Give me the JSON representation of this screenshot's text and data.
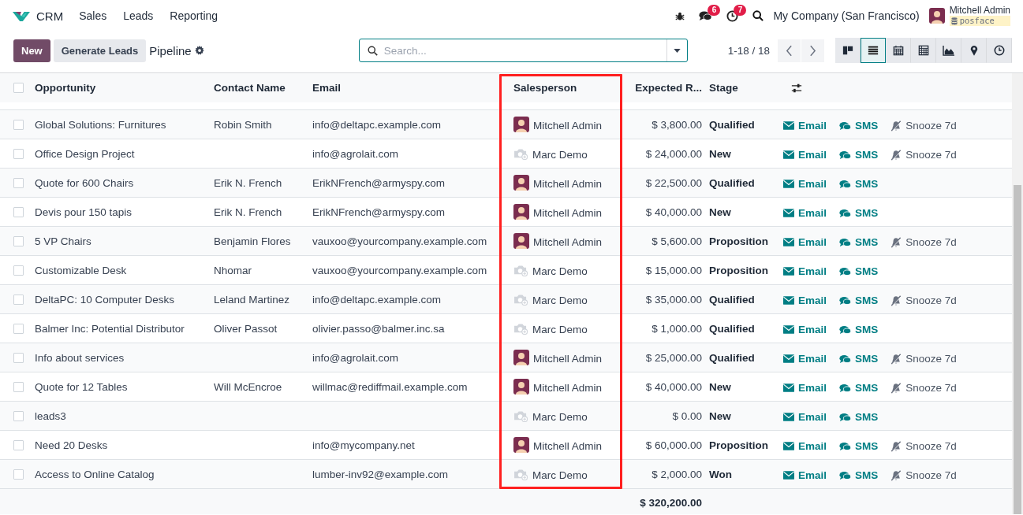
{
  "nav": {
    "app": "CRM",
    "menu": [
      "Sales",
      "Leads",
      "Reporting"
    ]
  },
  "systray": {
    "messages_badge": "6",
    "activities_badge": "7",
    "company": "My Company (San Francisco)",
    "user": "Mitchell Admin",
    "database": "posface"
  },
  "control_panel": {
    "new_button": "New",
    "generate_button": "Generate Leads",
    "breadcrumb": "Pipeline",
    "search": {
      "placeholder": "Search..."
    },
    "pager": "1-18 / 18",
    "views": [
      {
        "kind": "kanban",
        "selected": false
      },
      {
        "kind": "list",
        "selected": true
      },
      {
        "kind": "calendar",
        "selected": false
      },
      {
        "kind": "pivot",
        "selected": false
      },
      {
        "kind": "graph",
        "selected": false
      },
      {
        "kind": "map",
        "selected": false
      },
      {
        "kind": "activity",
        "selected": false
      }
    ]
  },
  "table": {
    "all_checked": false,
    "columns": [
      {
        "label": "Opportunity",
        "highlighted": false
      },
      {
        "label": "Contact Name",
        "highlighted": false
      },
      {
        "label": "Email",
        "highlighted": false
      },
      {
        "label": "Salesperson",
        "highlighted": true
      },
      {
        "label": "Expected R...",
        "highlighted": false
      },
      {
        "label": "Stage",
        "highlighted": false
      }
    ],
    "rows": [
      {
        "checked": false,
        "opportunity": "Global Solutions: Furnitures",
        "contact": "Robin Smith",
        "email": "info@deltapc.example.com",
        "salesperson": "Mitchell Admin",
        "has_avatar": true,
        "revenue": "$ 3,800.00",
        "stage": "Qualified",
        "actions": [
          {
            "kind": "email",
            "label": "Email"
          },
          {
            "kind": "sms",
            "label": "SMS"
          },
          {
            "kind": "snooze",
            "label": "Snooze 7d"
          }
        ]
      },
      {
        "checked": false,
        "opportunity": "Office Design Project",
        "contact": "",
        "email": "info@agrolait.com",
        "salesperson": "Marc Demo",
        "has_avatar": false,
        "revenue": "$ 24,000.00",
        "stage": "New",
        "actions": [
          {
            "kind": "email",
            "label": "Email"
          },
          {
            "kind": "sms",
            "label": "SMS"
          },
          {
            "kind": "snooze",
            "label": "Snooze 7d"
          }
        ]
      },
      {
        "checked": false,
        "opportunity": "Quote for 600 Chairs",
        "contact": "Erik N. French",
        "email": "ErikNFrench@armyspy.com",
        "salesperson": "Mitchell Admin",
        "has_avatar": true,
        "revenue": "$ 22,500.00",
        "stage": "Qualified",
        "actions": [
          {
            "kind": "email",
            "label": "Email"
          },
          {
            "kind": "sms",
            "label": "SMS"
          }
        ]
      },
      {
        "checked": false,
        "opportunity": "Devis pour 150 tapis",
        "contact": "Erik N. French",
        "email": "ErikNFrench@armyspy.com",
        "salesperson": "Mitchell Admin",
        "has_avatar": true,
        "revenue": "$ 40,000.00",
        "stage": "New",
        "actions": [
          {
            "kind": "email",
            "label": "Email"
          },
          {
            "kind": "sms",
            "label": "SMS"
          }
        ]
      },
      {
        "checked": false,
        "opportunity": "5 VP Chairs",
        "contact": "Benjamin Flores",
        "email": "vauxoo@yourcompany.example.com",
        "salesperson": "Mitchell Admin",
        "has_avatar": true,
        "revenue": "$ 5,600.00",
        "stage": "Proposition",
        "actions": [
          {
            "kind": "email",
            "label": "Email"
          },
          {
            "kind": "sms",
            "label": "SMS"
          },
          {
            "kind": "snooze",
            "label": "Snooze 7d"
          }
        ]
      },
      {
        "checked": false,
        "opportunity": "Customizable Desk",
        "contact": "Nhomar",
        "email": "vauxoo@yourcompany.example.com",
        "salesperson": "Marc Demo",
        "has_avatar": false,
        "revenue": "$ 15,000.00",
        "stage": "Proposition",
        "actions": [
          {
            "kind": "email",
            "label": "Email"
          },
          {
            "kind": "sms",
            "label": "SMS"
          }
        ]
      },
      {
        "checked": false,
        "opportunity": "DeltaPC: 10 Computer Desks",
        "contact": "Leland Martinez",
        "email": "info@deltapc.example.com",
        "salesperson": "Marc Demo",
        "has_avatar": false,
        "revenue": "$ 35,000.00",
        "stage": "Qualified",
        "actions": [
          {
            "kind": "email",
            "label": "Email"
          },
          {
            "kind": "sms",
            "label": "SMS"
          },
          {
            "kind": "snooze",
            "label": "Snooze 7d"
          }
        ]
      },
      {
        "checked": false,
        "opportunity": "Balmer Inc: Potential Distributor",
        "contact": "Oliver Passot",
        "email": "olivier.passo@balmer.inc.sa",
        "salesperson": "Marc Demo",
        "has_avatar": false,
        "revenue": "$ 1,000.00",
        "stage": "Qualified",
        "actions": [
          {
            "kind": "email",
            "label": "Email"
          },
          {
            "kind": "sms",
            "label": "SMS"
          }
        ]
      },
      {
        "checked": false,
        "opportunity": "Info about services",
        "contact": "",
        "email": "info@agrolait.com",
        "salesperson": "Mitchell Admin",
        "has_avatar": true,
        "revenue": "$ 25,000.00",
        "stage": "Qualified",
        "actions": [
          {
            "kind": "email",
            "label": "Email"
          },
          {
            "kind": "sms",
            "label": "SMS"
          },
          {
            "kind": "snooze",
            "label": "Snooze 7d"
          }
        ]
      },
      {
        "checked": false,
        "opportunity": "Quote for 12 Tables",
        "contact": "Will McEncroe",
        "email": "willmac@rediffmail.example.com",
        "salesperson": "Mitchell Admin",
        "has_avatar": true,
        "revenue": "$ 40,000.00",
        "stage": "New",
        "actions": [
          {
            "kind": "email",
            "label": "Email"
          },
          {
            "kind": "sms",
            "label": "SMS"
          },
          {
            "kind": "snooze",
            "label": "Snooze 7d"
          }
        ]
      },
      {
        "checked": false,
        "opportunity": "leads3",
        "contact": "",
        "email": "",
        "salesperson": "Marc Demo",
        "has_avatar": false,
        "revenue": "$ 0.00",
        "stage": "New",
        "actions": [
          {
            "kind": "email",
            "label": "Email"
          },
          {
            "kind": "sms",
            "label": "SMS"
          }
        ]
      },
      {
        "checked": false,
        "opportunity": "Need 20 Desks",
        "contact": "",
        "email": "info@mycompany.net",
        "salesperson": "Mitchell Admin",
        "has_avatar": true,
        "revenue": "$ 60,000.00",
        "stage": "Proposition",
        "actions": [
          {
            "kind": "email",
            "label": "Email"
          },
          {
            "kind": "sms",
            "label": "SMS"
          },
          {
            "kind": "snooze",
            "label": "Snooze 7d"
          }
        ]
      },
      {
        "checked": false,
        "opportunity": "Access to Online Catalog",
        "contact": "",
        "email": "lumber-inv92@example.com",
        "salesperson": "Marc Demo",
        "has_avatar": false,
        "revenue": "$ 2,000.00",
        "stage": "Won",
        "actions": [
          {
            "kind": "email",
            "label": "Email"
          },
          {
            "kind": "sms",
            "label": "SMS"
          },
          {
            "kind": "snooze",
            "label": "Snooze 7d"
          }
        ]
      }
    ],
    "total": "$ 320,200.00"
  }
}
